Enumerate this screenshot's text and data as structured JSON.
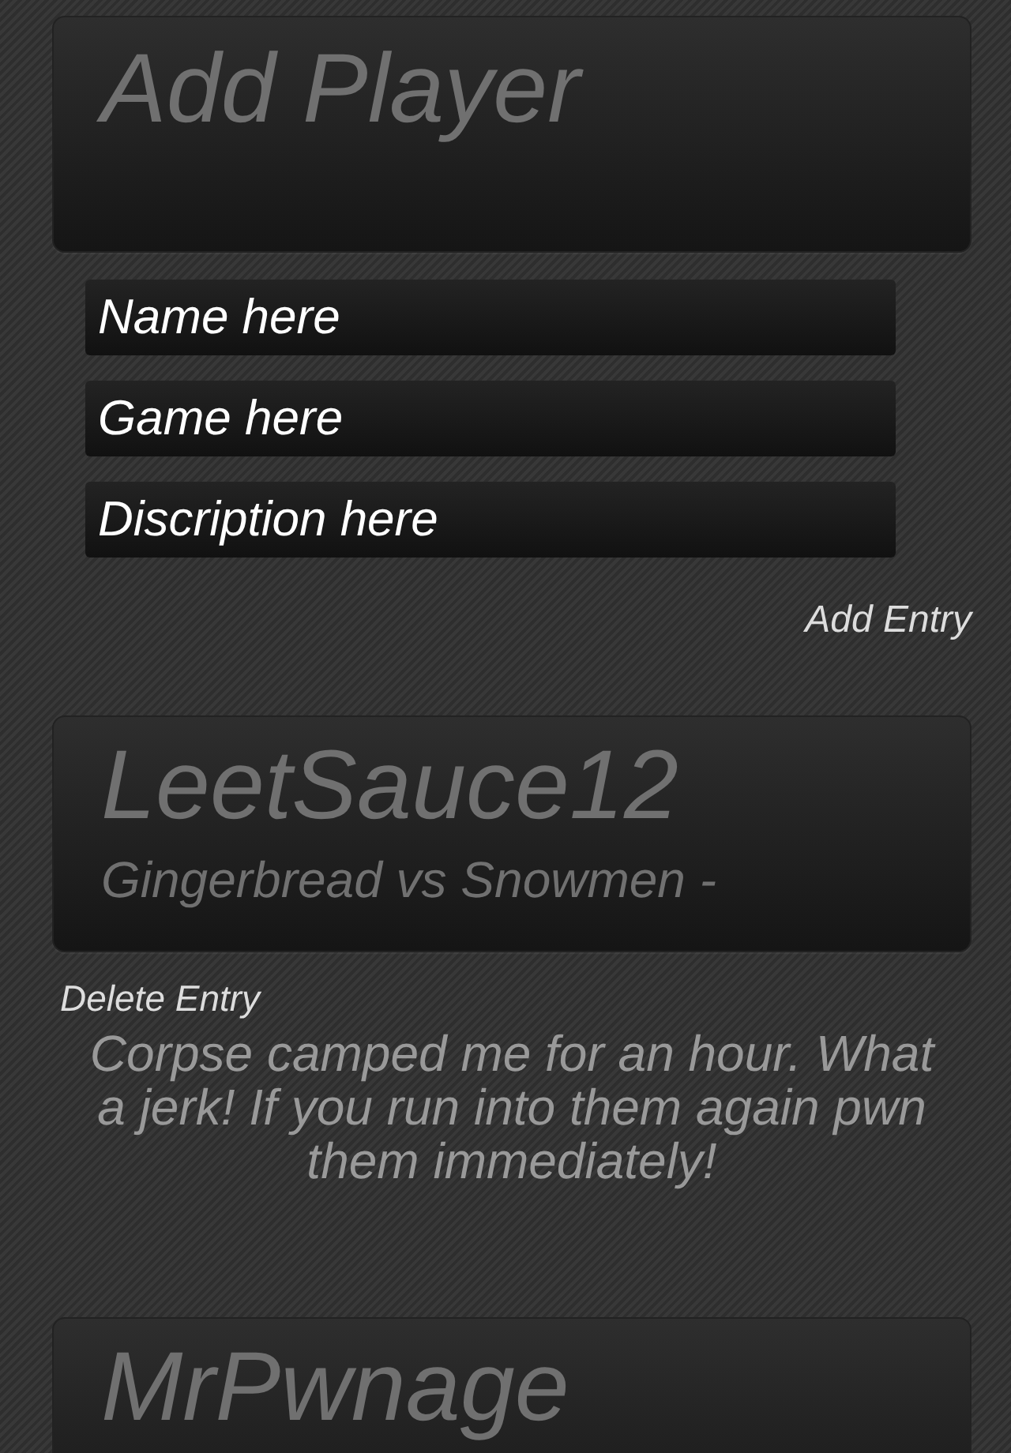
{
  "add_player": {
    "title": "Add Player",
    "fields": [
      {
        "placeholder": "Name here"
      },
      {
        "placeholder": "Game here"
      },
      {
        "placeholder": "Discription here"
      }
    ],
    "add_button": "Add Entry"
  },
  "entries": [
    {
      "name": "LeetSauce12",
      "game": "Gingerbread vs Snowmen -",
      "delete_button": "Delete Entry",
      "description": "Corpse camped me for an hour. What a jerk! If you run into them again pwn them immediately!"
    },
    {
      "name": "MrPwnage"
    }
  ]
}
